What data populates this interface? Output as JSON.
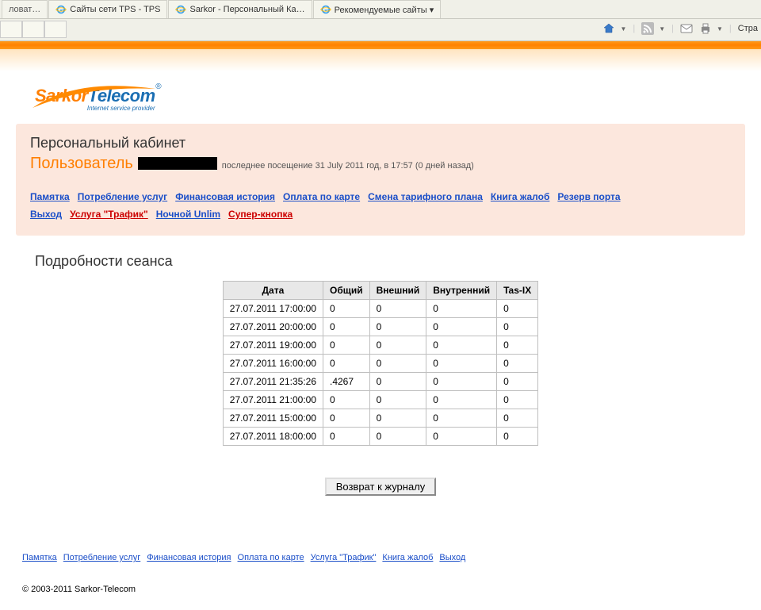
{
  "tabs": [
    {
      "label": "ловат…"
    },
    {
      "label": "Сайты сети TPS - TPS"
    },
    {
      "label": "Sarkor - Персональный Ка…"
    },
    {
      "label": "Рекомендуемые сайты ▾"
    }
  ],
  "toolbar_right_label": "Стра",
  "logo": {
    "part1": "Sarkor",
    "part2": "Telecom",
    "sub": "Internet service provider"
  },
  "panel": {
    "title": "Персональный кабинет",
    "user_label": "Пользователь",
    "last_visit": "последнее посещение 31 July 2011 год, в 17:57 (0 дней назад)"
  },
  "nav": {
    "row1": [
      {
        "text": "Памятка",
        "red": false
      },
      {
        "text": "Потребление услуг",
        "red": false
      },
      {
        "text": "Финансовая история",
        "red": false
      },
      {
        "text": "Оплата по карте",
        "red": false
      },
      {
        "text": "Смена тарифного плана",
        "red": false
      },
      {
        "text": "Книга жалоб",
        "red": false
      },
      {
        "text": "Резерв порта",
        "red": false
      }
    ],
    "row2": [
      {
        "text": "Выход",
        "red": false
      },
      {
        "text": "Услуга \"Трафик\"",
        "red": true
      },
      {
        "text": "Ночной Unlim",
        "red": false
      },
      {
        "text": "Супер-кнопка",
        "red": true
      }
    ]
  },
  "section_title": "Подробности сеанса",
  "table": {
    "headers": [
      "Дата",
      "Общий",
      "Внешний",
      "Внутренний",
      "Tas-IX"
    ],
    "rows": [
      [
        "27.07.2011 17:00:00",
        "0",
        "0",
        "0",
        "0"
      ],
      [
        "27.07.2011 20:00:00",
        "0",
        "0",
        "0",
        "0"
      ],
      [
        "27.07.2011 19:00:00",
        "0",
        "0",
        "0",
        "0"
      ],
      [
        "27.07.2011 16:00:00",
        "0",
        "0",
        "0",
        "0"
      ],
      [
        "27.07.2011 21:35:26",
        ".4267",
        "0",
        "0",
        "0"
      ],
      [
        "27.07.2011 21:00:00",
        "0",
        "0",
        "0",
        "0"
      ],
      [
        "27.07.2011 15:00:00",
        "0",
        "0",
        "0",
        "0"
      ],
      [
        "27.07.2011 18:00:00",
        "0",
        "0",
        "0",
        "0"
      ]
    ]
  },
  "return_button": "Возврат к журналу",
  "footer_links": [
    "Памятка",
    "Потребление услуг",
    "Финансовая история",
    "Оплата по карте",
    "Услуга \"Трафик\"",
    "Книга жалоб",
    "Выход"
  ],
  "copyright": "© 2003-2011 Sarkor-Telecom"
}
